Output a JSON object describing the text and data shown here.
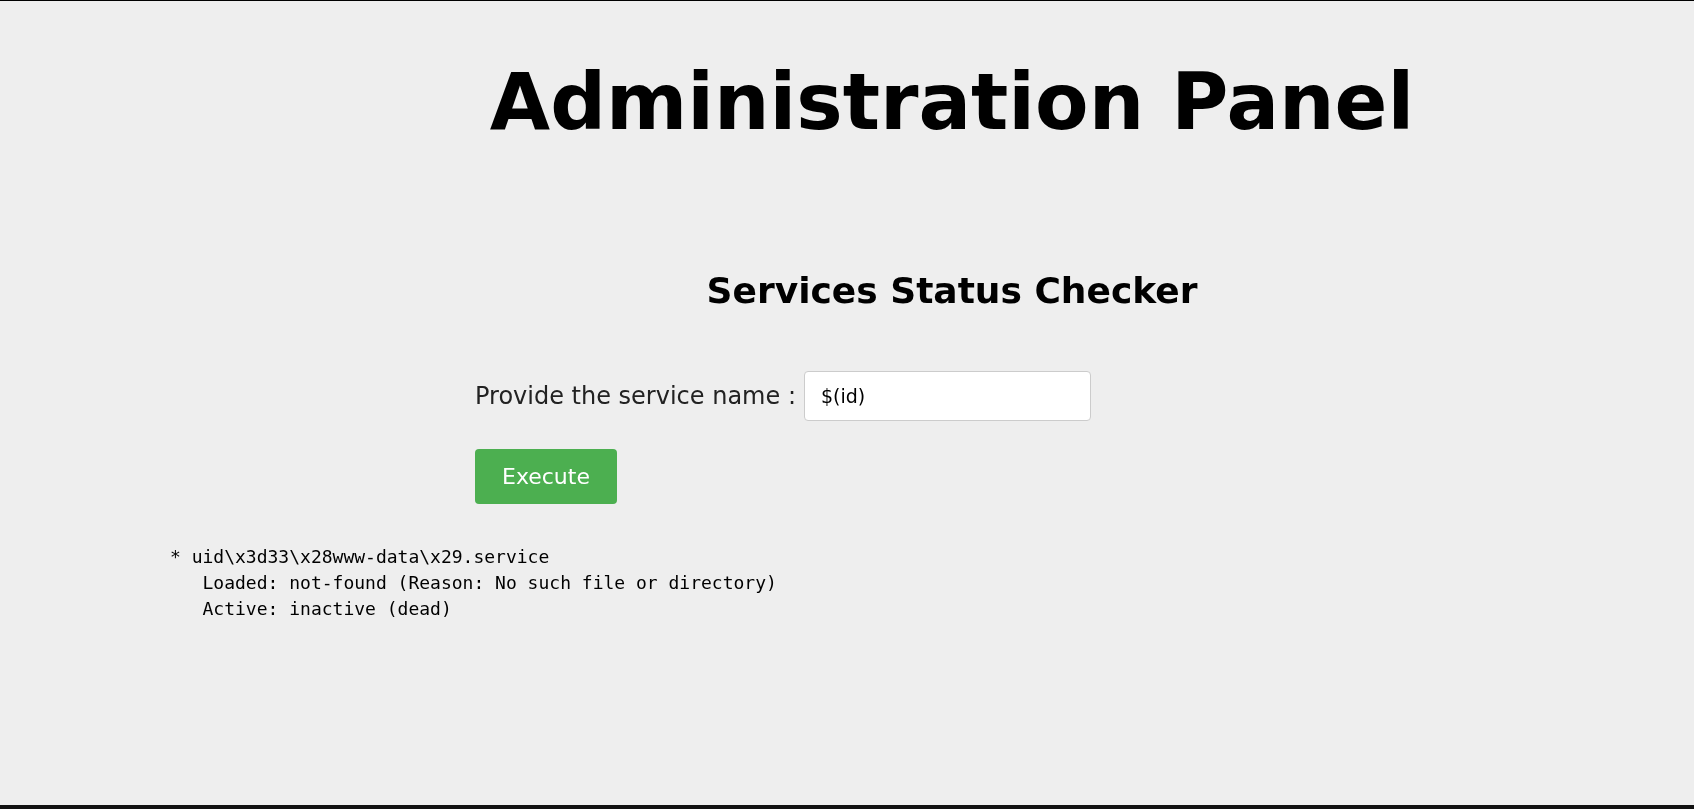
{
  "title": "Administration Panel",
  "subtitle": "Services Status Checker",
  "form": {
    "label": "Provide the service name :",
    "value": "$(id)",
    "button": "Execute"
  },
  "output": [
    "* uid\\x3d33\\x28www-data\\x29.service",
    "   Loaded: not-found (Reason: No such file or directory)",
    "   Active: inactive (dead)"
  ]
}
